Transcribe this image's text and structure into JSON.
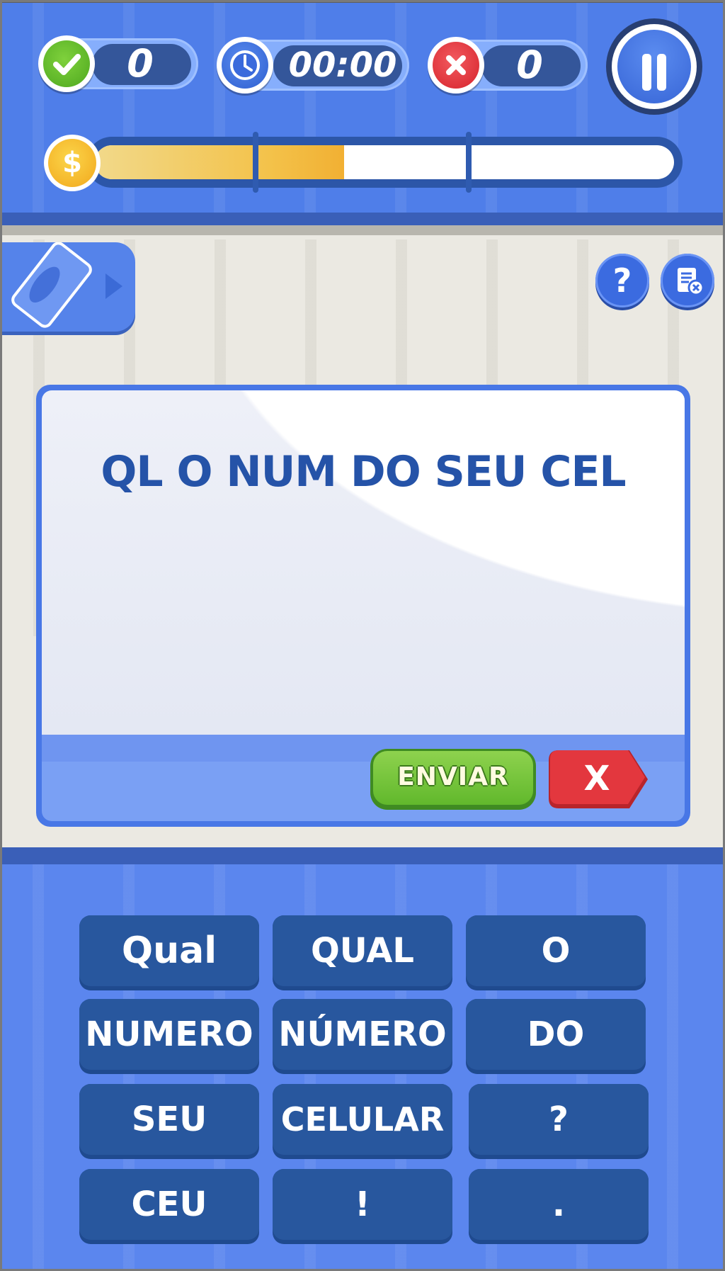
{
  "hud": {
    "correct_count": "0",
    "timer": "00:00",
    "wrong_count": "0",
    "correct_icon": "check-icon",
    "timer_icon": "clock-icon",
    "wrong_icon": "x-icon",
    "pause_icon": "pause-icon",
    "coin_symbol": "$",
    "progress_fraction": 0.43
  },
  "tools": {
    "card_icon": "card-icon",
    "help_label": "?",
    "clear_icon": "clear-document-icon"
  },
  "question": {
    "text": "QL O NUM DO SEU CEL"
  },
  "actions": {
    "send_label": "ENVIAR",
    "close_label": "X"
  },
  "keys": [
    {
      "label": "Qual"
    },
    {
      "label": "QUAL"
    },
    {
      "label": "O"
    },
    {
      "label": "NUMERO"
    },
    {
      "label": "NÚMERO"
    },
    {
      "label": "DO"
    },
    {
      "label": "SEU"
    },
    {
      "label": "CELULAR"
    },
    {
      "label": "?"
    },
    {
      "label": "CEU"
    },
    {
      "label": "!"
    },
    {
      "label": "."
    }
  ],
  "colors": {
    "hud_blue": "#4f7ee9",
    "text_blue": "#2553a8",
    "key_blue": "#28579e",
    "send_green": "#61b82c",
    "close_red": "#e3373e",
    "coin_gold": "#f2a81c"
  }
}
